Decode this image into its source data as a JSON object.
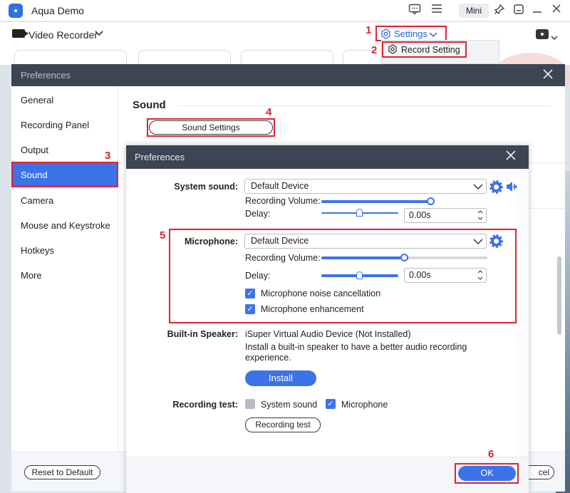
{
  "app": {
    "title": "Aqua Demo",
    "mini_label": "Mini",
    "mode_label": "Video Recorder",
    "settings_label": "Settings",
    "dropdown_item": "Record Setting"
  },
  "preferences": {
    "title": "Preferences",
    "sidebar": [
      "General",
      "Recording Panel",
      "Output",
      "Sound",
      "Camera",
      "Mouse and Keystroke",
      "Hotkeys",
      "More"
    ],
    "selected": "Sound",
    "section_heading": "Sound",
    "sound_settings_button": "Sound Settings",
    "reset_button": "Reset to Default",
    "cancel_button_partial": "cel"
  },
  "sound_dialog": {
    "title": "Preferences",
    "system_sound": {
      "label": "System sound:",
      "device": "Default Device",
      "recording_volume_label": "Recording Volume:",
      "volume": 1.0,
      "delay_label": "Delay:",
      "delay_value": "0.00s",
      "delay_position": 0.5
    },
    "microphone": {
      "label": "Microphone:",
      "device": "Default Device",
      "recording_volume_label": "Recording Volume:",
      "volume": 0.5,
      "delay_label": "Delay:",
      "delay_value": "0.00s",
      "delay_position": 0.5,
      "noise_cancellation_label": "Microphone noise cancellation",
      "noise_cancellation": true,
      "enhancement_label": "Microphone enhancement",
      "enhancement": true
    },
    "builtin_speaker": {
      "label": "Built-in Speaker:",
      "device": "iSuper Virtual Audio Device (Not Installed)",
      "description_line1": "Install a built-in speaker to have a better audio recording",
      "description_line2": "experience.",
      "install_button": "Install"
    },
    "recording_test": {
      "label": "Recording test:",
      "system_sound_label": "System sound",
      "system_sound_checked": false,
      "microphone_label": "Microphone",
      "microphone_checked": true,
      "button": "Recording test"
    },
    "ok_button": "OK"
  },
  "steps": [
    "1",
    "2",
    "3",
    "4",
    "5",
    "6"
  ],
  "colors": {
    "accent": "#3d73e8",
    "highlight": "#e0222f",
    "header": "#3c4554"
  }
}
